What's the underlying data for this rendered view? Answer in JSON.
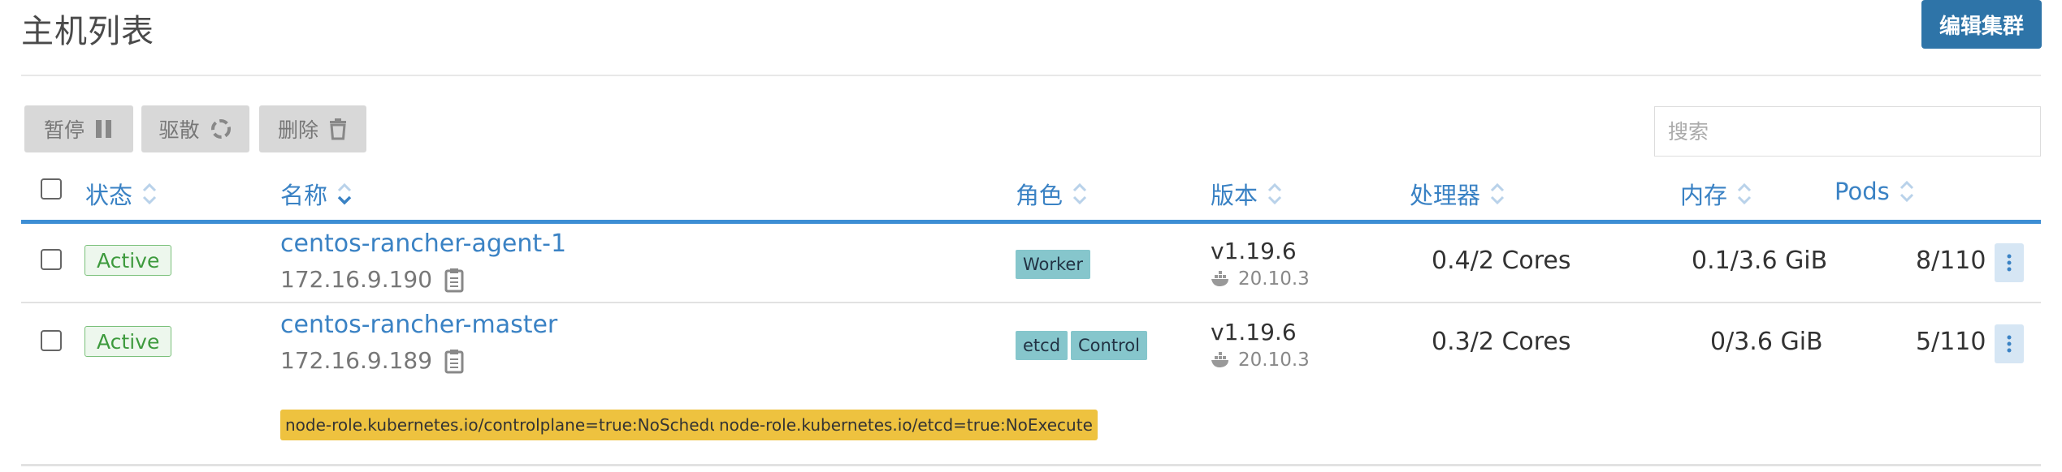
{
  "page": {
    "title": "主机列表",
    "edit_button": "编辑集群"
  },
  "toolbar": {
    "pause_label": "暂停",
    "evict_label": "驱散",
    "delete_label": "删除",
    "search_placeholder": "搜索"
  },
  "table": {
    "headers": {
      "state": "状态",
      "name": "名称",
      "role": "角色",
      "version": "版本",
      "cpu": "处理器",
      "memory": "内存",
      "pods": "Pods"
    },
    "rows": [
      {
        "state": "Active",
        "name": "centos-rancher-agent-1",
        "ip": "172.16.9.190",
        "roles": [
          "Worker"
        ],
        "version": "v1.19.6",
        "docker": "20.10.3",
        "cpu": "0.4/2 Cores",
        "memory": "0.1/3.6 GiB",
        "pods": "8/110"
      },
      {
        "state": "Active",
        "name": "centos-rancher-master",
        "ip": "172.16.9.189",
        "roles": [
          "etcd",
          "Control"
        ],
        "version": "v1.19.6",
        "docker": "20.10.3",
        "cpu": "0.3/2 Cores",
        "memory": "0/3.6 GiB",
        "pods": "5/110",
        "taints": [
          "node-role.kubernetes.io/controlplane=true:NoSchedule",
          "node-role.kubernetes.io/etcd=true:NoExecute"
        ]
      }
    ]
  },
  "colors": {
    "accent": "#3a82c4",
    "primary_button": "#2e74a8",
    "active_badge": "#3d9a3d",
    "role_badge": "#86c6cc",
    "taint_badge": "#eec23f"
  },
  "icons": [
    "pause-icon",
    "evict-icon",
    "trash-icon",
    "sort-icon",
    "copy-icon",
    "docker-icon",
    "kebab-icon"
  ]
}
